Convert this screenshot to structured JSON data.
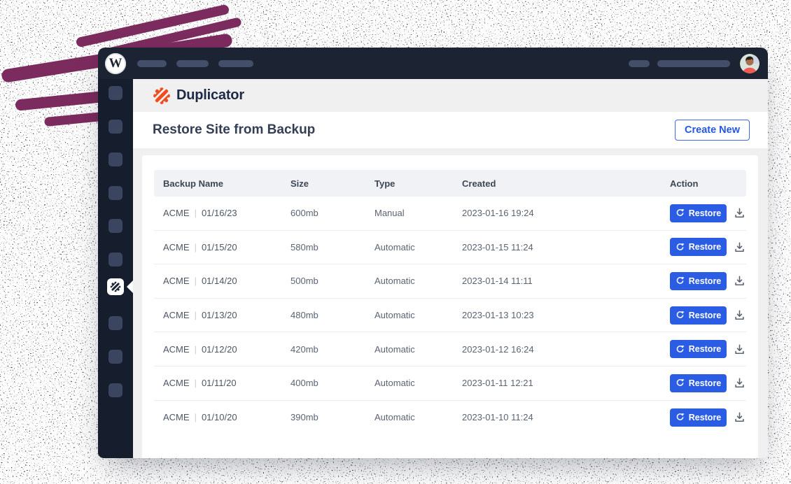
{
  "topbar": {
    "wordpress_logo_letter": "W",
    "icons": {
      "wordpress": "wordpress-icon",
      "avatar": "user-avatar"
    }
  },
  "brand": {
    "name": "Duplicator",
    "logo_icon": "duplicator-gear-icon"
  },
  "page": {
    "title": "Restore Site from Backup",
    "create_button": "Create New"
  },
  "table": {
    "columns": [
      "Backup Name",
      "Size",
      "Type",
      "Created",
      "Action"
    ],
    "name_separator": "|",
    "restore_button": "Restore",
    "icons": {
      "restore": "restore-rotate-icon",
      "download": "download-icon"
    },
    "rows": [
      {
        "name": "ACME",
        "date": "01/16/23",
        "size": "600mb",
        "type": "Manual",
        "created": "2023-01-16 19:24"
      },
      {
        "name": "ACME",
        "date": "01/15/20",
        "size": "580mb",
        "type": "Automatic",
        "created": "2023-01-15 11:24"
      },
      {
        "name": "ACME",
        "date": "01/14/20",
        "size": "500mb",
        "type": "Automatic",
        "created": "2023-01-14 11:11"
      },
      {
        "name": "ACME",
        "date": "01/13/20",
        "size": "480mb",
        "type": "Automatic",
        "created": "2023-01-13 10:23"
      },
      {
        "name": "ACME",
        "date": "01/12/20",
        "size": "420mb",
        "type": "Automatic",
        "created": "2023-01-12 16:24"
      },
      {
        "name": "ACME",
        "date": "01/11/20",
        "size": "400mb",
        "type": "Automatic",
        "created": "2023-01-11 12:21"
      },
      {
        "name": "ACME",
        "date": "01/10/20",
        "size": "390mb",
        "type": "Automatic",
        "created": "2023-01-10 11:24"
      }
    ]
  },
  "colors": {
    "accent_blue": "#2b5ce4",
    "brand_orange": "#ee4e1f",
    "brand_navy": "#1e2a45",
    "topbar_dark": "#1c2433",
    "sidebar_dark": "#161e2d",
    "plum_stroke": "#7c2b5e",
    "content_gray": "#f0f0f1"
  }
}
